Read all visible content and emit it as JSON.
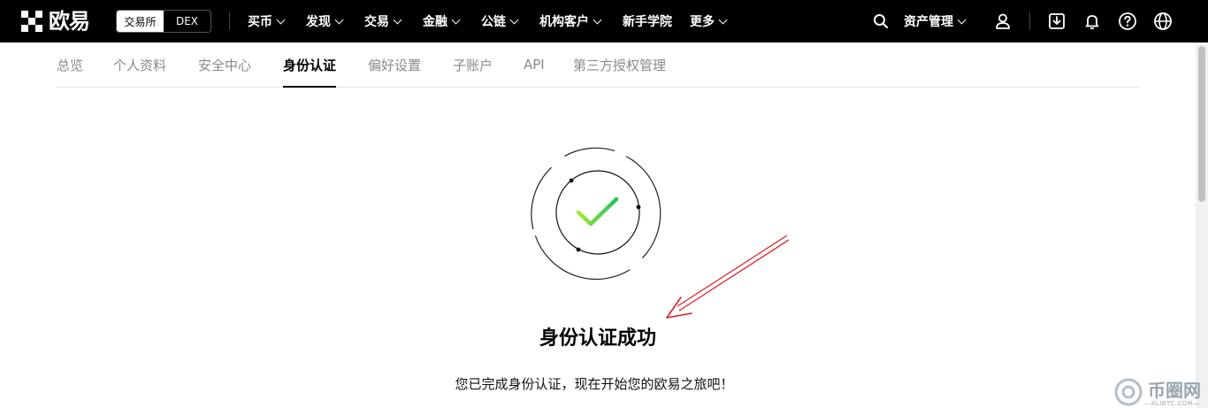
{
  "header": {
    "brand": "欧易",
    "mode_switch": [
      "交易所",
      "DEX"
    ],
    "nav": [
      {
        "label": "买币",
        "dropdown": true
      },
      {
        "label": "发现",
        "dropdown": true
      },
      {
        "label": "交易",
        "dropdown": true
      },
      {
        "label": "金融",
        "dropdown": true
      },
      {
        "label": "公链",
        "dropdown": true
      },
      {
        "label": "机构客户",
        "dropdown": true
      },
      {
        "label": "新手学院",
        "dropdown": false
      },
      {
        "label": "更多",
        "dropdown": true
      }
    ],
    "asset_management": "资产管理",
    "icons": [
      "search-icon",
      "user-icon",
      "download-icon",
      "bell-icon",
      "help-icon",
      "globe-icon"
    ]
  },
  "tabs": {
    "items": [
      "总览",
      "个人资料",
      "安全中心",
      "身份认证",
      "偏好设置",
      "子账户",
      "API",
      "第三方授权管理"
    ],
    "active": "身份认证"
  },
  "status": {
    "title": "身份认证成功",
    "message": "您已完成身份认证，现在开始您的欧易之旅吧！"
  },
  "colors": {
    "check_gradient": [
      "#a3e635",
      "#22c55e"
    ],
    "annotation_arrow": "#d9232b"
  },
  "watermark": {
    "text": "币圈网",
    "sub": "—ALIBTC.COM—"
  }
}
